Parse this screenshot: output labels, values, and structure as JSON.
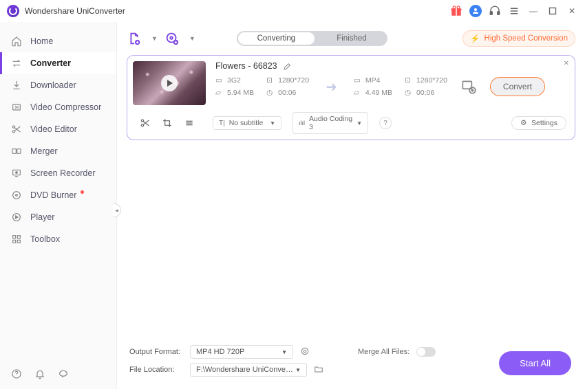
{
  "app_title": "Wondershare UniConverter",
  "sidebar": {
    "items": [
      {
        "label": "Home"
      },
      {
        "label": "Converter"
      },
      {
        "label": "Downloader"
      },
      {
        "label": "Video Compressor"
      },
      {
        "label": "Video Editor"
      },
      {
        "label": "Merger"
      },
      {
        "label": "Screen Recorder"
      },
      {
        "label": "DVD Burner"
      },
      {
        "label": "Player"
      },
      {
        "label": "Toolbox"
      }
    ]
  },
  "tabs": {
    "converting": "Converting",
    "finished": "Finished"
  },
  "high_speed": "High Speed Conversion",
  "file": {
    "title": "Flowers - 66823",
    "src": {
      "format": "3G2",
      "resolution": "1280*720",
      "size": "5.94 MB",
      "duration": "00:06"
    },
    "dst": {
      "format": "MP4",
      "resolution": "1280*720",
      "size": "4.49 MB",
      "duration": "00:06"
    },
    "convert_btn": "Convert",
    "subtitle": "No subtitle",
    "audio": "Audio Coding 3",
    "settings": "Settings"
  },
  "footer": {
    "output_format_label": "Output Format:",
    "output_format": "MP4 HD 720P",
    "file_location_label": "File Location:",
    "file_location": "F:\\Wondershare UniConverter",
    "merge_label": "Merge All Files:",
    "start_all": "Start All"
  }
}
